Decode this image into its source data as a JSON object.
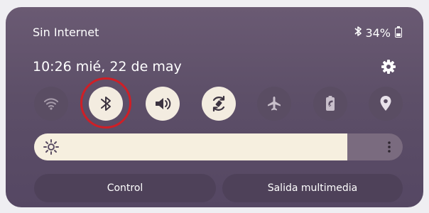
{
  "status": {
    "network_label": "Sin Internet",
    "battery_percent": "34%",
    "icons": [
      "bluetooth-icon",
      "battery-icon"
    ]
  },
  "header": {
    "time": "10:26",
    "date": "mié, 22 de may",
    "settings_icon": "gear-icon"
  },
  "quick_toggles": [
    {
      "name": "wifi",
      "icon": "wifi-icon",
      "state": "off"
    },
    {
      "name": "bluetooth",
      "icon": "bluetooth-icon",
      "state": "on"
    },
    {
      "name": "sound",
      "icon": "sound-icon",
      "state": "on"
    },
    {
      "name": "auto-rotate",
      "icon": "auto-rotate-icon",
      "state": "on"
    },
    {
      "name": "airplane-mode",
      "icon": "airplane-icon",
      "state": "off"
    },
    {
      "name": "battery-saver",
      "icon": "battery-saver-icon",
      "state": "off"
    },
    {
      "name": "location",
      "icon": "location-icon",
      "state": "off"
    }
  ],
  "brightness": {
    "level": 0.85,
    "icons": [
      "sun-icon",
      "more-vertical-icon"
    ]
  },
  "buttons": {
    "control_label": "Control",
    "media_output_label": "Salida multimedia"
  },
  "colors": {
    "panel": "#5d4f68",
    "toggle_on": "#f3ece0",
    "toggle_off": "#5a4d63",
    "highlight": "#cf1f26"
  }
}
